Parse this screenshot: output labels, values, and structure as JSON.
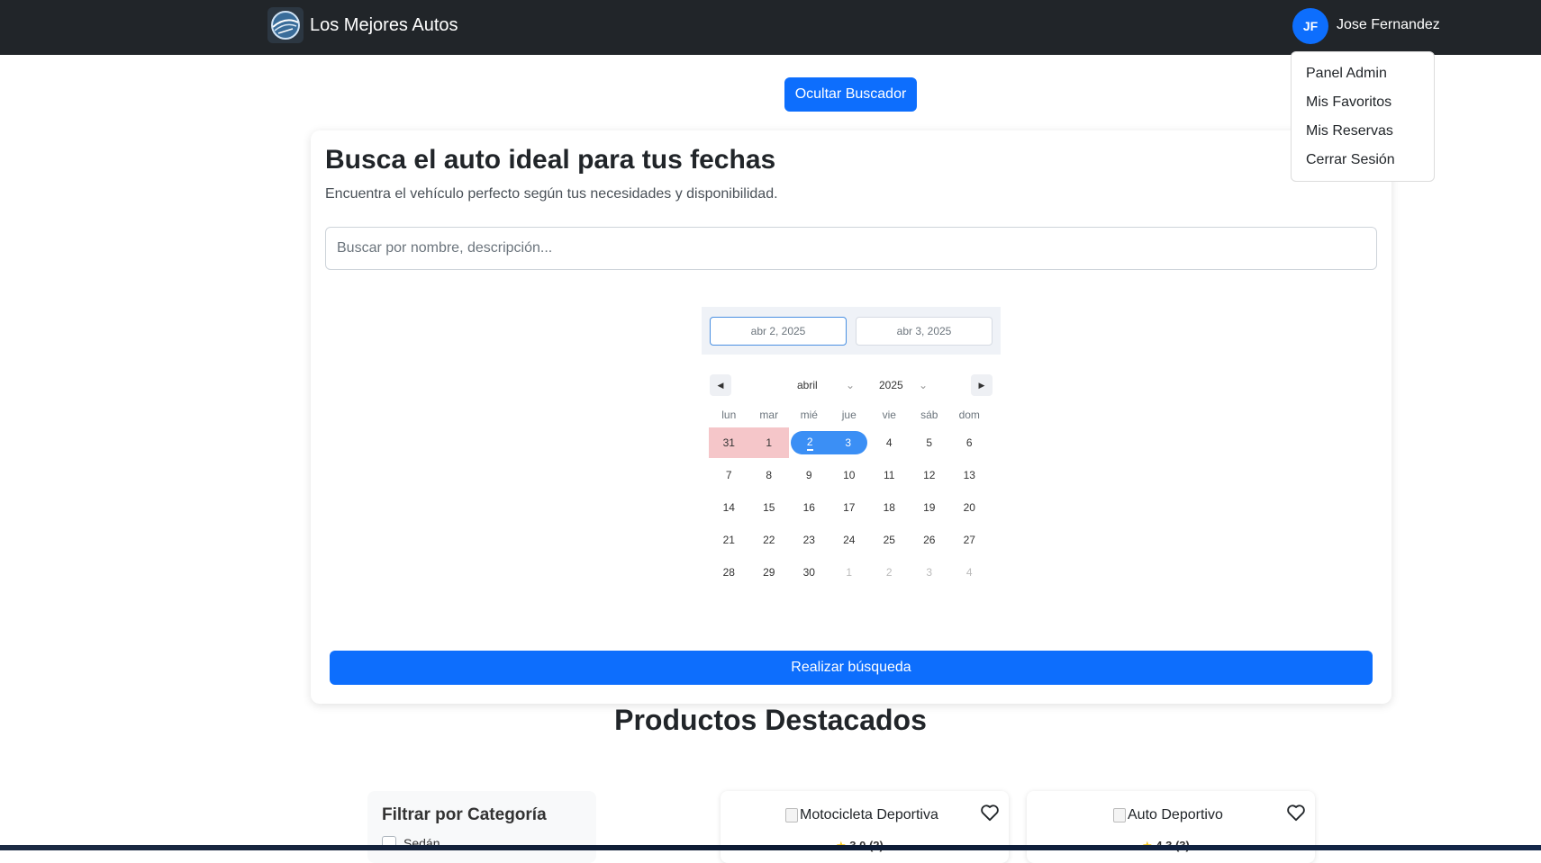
{
  "navbar": {
    "brand": "Los Mejores Autos",
    "logo_icon": "car-speed-logo-icon",
    "avatar_initials": "JF",
    "user_name": "Jose Fernandez"
  },
  "user_menu": {
    "items": [
      {
        "label": "Panel Admin"
      },
      {
        "label": "Mis Favoritos"
      },
      {
        "label": "Mis Reservas"
      },
      {
        "label": "Cerrar Sesión"
      }
    ]
  },
  "toggle_search_label": "Ocultar Buscador",
  "search_card": {
    "title": "Busca el auto ideal para tus fechas",
    "subtitle": "Encuentra el vehículo perfecto según tus necesidades y disponibilidad.",
    "search_placeholder": "Buscar por nombre, descripción...",
    "search_value": "",
    "submit_label": "Realizar búsqueda"
  },
  "datepicker": {
    "start_date": "abr 2, 2025",
    "end_date": "abr 3, 2025",
    "month": "abril",
    "year": "2025",
    "weekdays": [
      "lun",
      "mar",
      "mié",
      "jue",
      "vie",
      "sáb",
      "dom"
    ],
    "weeks": [
      [
        "31",
        "1",
        "2",
        "3",
        "4",
        "5",
        "6"
      ],
      [
        "7",
        "8",
        "9",
        "10",
        "11",
        "12",
        "13"
      ],
      [
        "14",
        "15",
        "16",
        "17",
        "18",
        "19",
        "20"
      ],
      [
        "21",
        "22",
        "23",
        "24",
        "25",
        "26",
        "27"
      ],
      [
        "28",
        "29",
        "30",
        "1",
        "2",
        "3",
        "4"
      ]
    ],
    "unavailable_days": [
      "31",
      "1"
    ],
    "selected_start": "2",
    "selected_end": "3",
    "colors": {
      "range": "#3b8ff5",
      "unavailable": "#f5c6c9"
    }
  },
  "featured": {
    "title": "Productos Destacados",
    "filter": {
      "title": "Filtrar por Categoría",
      "options": [
        {
          "label": "Sedán",
          "checked": false
        }
      ]
    },
    "products": [
      {
        "image_alt": "Motocicleta Deportiva",
        "rating": "3.0 (2)",
        "favorite": false
      },
      {
        "image_alt": "Auto Deportivo",
        "rating": "4.3 (3)",
        "favorite": false
      }
    ]
  },
  "colors": {
    "primary": "#0d6efd",
    "navbar_bg": "#212529",
    "star": "#f5c518"
  }
}
